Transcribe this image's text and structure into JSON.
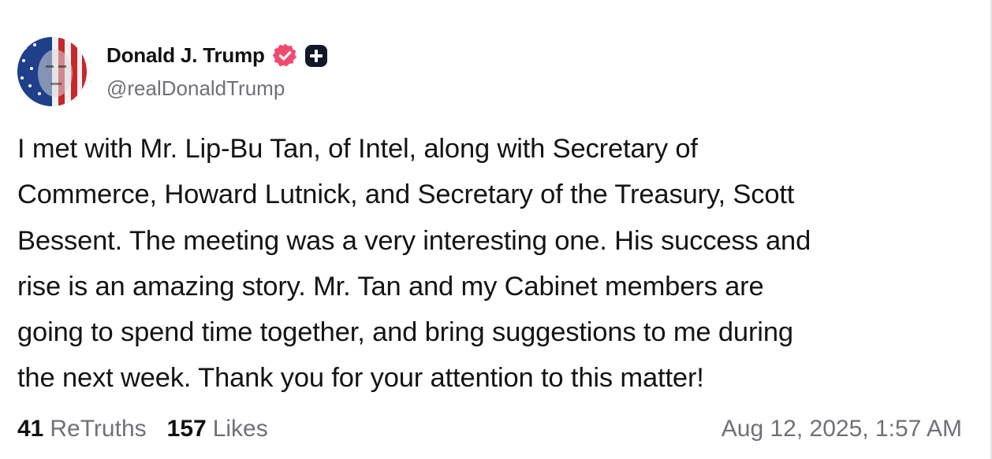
{
  "colors": {
    "verified_badge": "#f24a6f",
    "plus_badge": "#111827",
    "secondary_text": "#707078"
  },
  "post": {
    "author": {
      "display_name": "Donald J. Trump",
      "handle": "@realDonaldTrump",
      "badges": [
        "verified-check-icon",
        "plus-badge-icon"
      ]
    },
    "text_lines": [
      "I met with Mr. Lip-Bu Tan, of Intel, along with Secretary of",
      "Commerce, Howard Lutnick, and Secretary of the Treasury, Scott",
      "Bessent. The meeting was a very interesting one. His success and",
      "rise is an amazing story. Mr. Tan and my Cabinet members are",
      "going to spend time together, and bring suggestions to me during",
      "the next week. Thank you for your attention to this matter!"
    ],
    "stats": {
      "retruths_count": "41",
      "retruths_label": "ReTruths",
      "likes_count": "157",
      "likes_label": "Likes"
    },
    "timestamp": "Aug 12, 2025, 1:57 AM"
  }
}
